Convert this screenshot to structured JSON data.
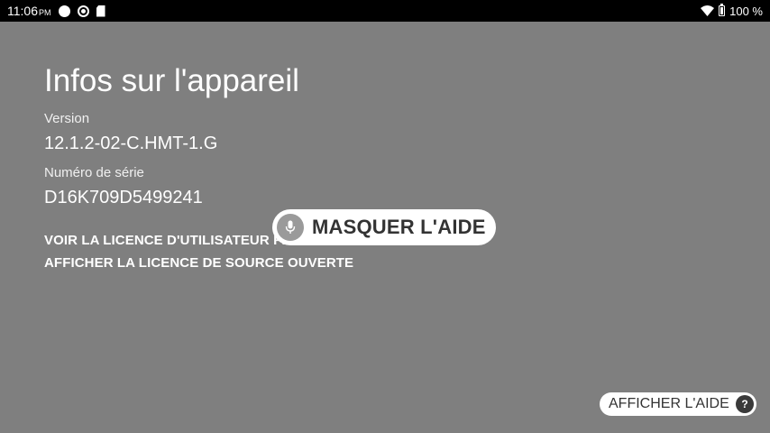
{
  "status_bar": {
    "time": "11:06",
    "ampm": "PM",
    "battery_text": "100 %",
    "icons": [
      "circle-notification-icon",
      "sync-icon",
      "sd-card-icon",
      "wifi-icon",
      "battery-icon"
    ]
  },
  "page": {
    "title": "Infos sur l'appareil",
    "version_label": "Version",
    "version_value": "12.1.2-02-C.HMT-1.G",
    "serial_label": "Numéro de série",
    "serial_value": "D16K709D5499241",
    "eula_link": "VOIR LA LICENCE D'UTILISATEUR FINAL",
    "oss_link": "AFFICHER LA LICENCE DE SOURCE OUVERTE"
  },
  "overlay": {
    "hide_help_label": "MASQUER L'AIDE",
    "show_help_label": "AFFICHER L'AIDE",
    "help_icon_glyph": "?"
  },
  "colors": {
    "background": "#7f7f7f",
    "status_bar": "#000000",
    "pill": "#ffffff",
    "pill_text": "#333333"
  }
}
